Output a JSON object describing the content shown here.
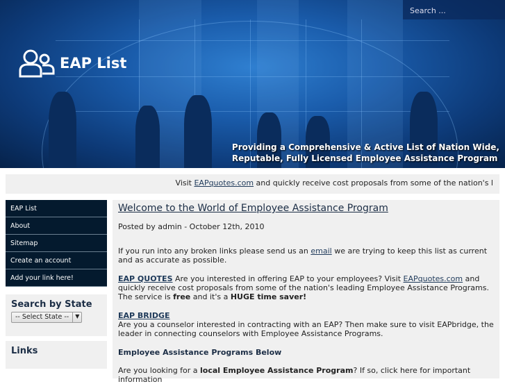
{
  "header": {
    "search_placeholder": "Search ...",
    "logo_text": "EAP List",
    "tagline_line1": "Providing a Comprehensive & Active List of Nation Wide,",
    "tagline_line2": "Reputable, Fully Licensed Employee Assistance Program"
  },
  "banner": {
    "prefix": "Visit ",
    "link": "EAPquotes.com",
    "suffix": " and quickly receive cost proposals from some of the nation's l"
  },
  "nav": [
    {
      "label": "EAP List"
    },
    {
      "label": "About"
    },
    {
      "label": "Sitemap"
    },
    {
      "label": "Create an account"
    },
    {
      "label": "Add your link here!"
    }
  ],
  "search_state": {
    "title": "Search by State",
    "select_value": "-- Select State --"
  },
  "links": {
    "title": "Links"
  },
  "main": {
    "title": "Welcome to the World of Employee Assistance Program",
    "posted": "Posted by admin - October 12th, 2010",
    "p1_a": "If you run into any broken links please send us an ",
    "p1_link": "email",
    "p1_b": " we are trying to keep this list as current and as accurate as possible.",
    "p2_link1": "EAP QUOTES",
    "p2_a": "  Are you interested in offering EAP to your employees? Visit ",
    "p2_link2": "EAPquotes.com",
    "p2_b": " and quickly receive cost proposals from some of the nation's leading Employee Assistance Programs. The service is ",
    "p2_free": "free",
    "p2_c": " and it's a ",
    "p2_huge": "HUGE time saver!",
    "p3_link": "EAP BRIDGE",
    "p3_text": "Are you a counselor interested in contracting with an EAP? Then make sure to visit EAPbridge, the leader in connecting counselors with Employee Assistance Programs.",
    "section": "Employee Assistance Programs Below",
    "p4_a": "Are you looking for a ",
    "p4_bold": "local Employee Assistance Program",
    "p4_b": "? If so, click here for important information"
  }
}
